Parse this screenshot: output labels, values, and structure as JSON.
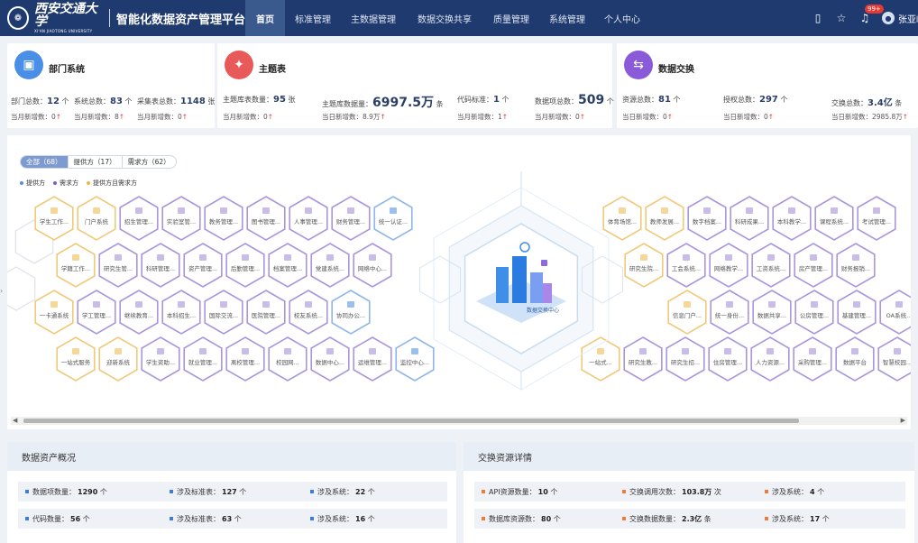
{
  "header": {
    "school_cn": "西安交通大学",
    "school_en": "XI'AN JIAOTONG UNIVERSITY",
    "platform_title": "智能化数据资产管理平台",
    "nav": [
      "首页",
      "标准管理",
      "主数据管理",
      "数据交换共享",
      "质量管理",
      "系统管理",
      "个人中心"
    ],
    "active_nav": "首页",
    "notification_badge": "99+",
    "user_name": "张亚峰"
  },
  "cards": {
    "dept": {
      "title": "部门系统",
      "icon_color": "#4a8fe7",
      "row1": [
        {
          "label": "部门总数：",
          "value": "12",
          "unit": "个"
        },
        {
          "label": "系统总数：",
          "value": "83",
          "unit": "个"
        },
        {
          "label": "采集表总数：",
          "value": "1148",
          "unit": "张"
        }
      ],
      "row2": [
        {
          "label": "当月新增数：",
          "value": "0"
        },
        {
          "label": "当月新增数：",
          "value": "8"
        },
        {
          "label": "当月新增数：",
          "value": "0"
        }
      ]
    },
    "theme": {
      "title": "主题表",
      "icon_color": "#e85a5a",
      "row1": [
        {
          "label": "主题库表数量：",
          "value": "95",
          "unit": "张"
        },
        {
          "label": "主题库数据量：",
          "value": "6997.5万",
          "unit": "条"
        },
        {
          "label": "代码标准：",
          "value": "1",
          "unit": "个"
        },
        {
          "label": "数据项总数：",
          "value": "509",
          "unit": "个"
        }
      ],
      "row2": [
        {
          "label": "当月新增数：",
          "value": "0"
        },
        {
          "label": "当日新增数：",
          "value": "8.9万"
        },
        {
          "label": "当月新增数：",
          "value": "1"
        },
        {
          "label": "当月新增数：",
          "value": "0"
        }
      ]
    },
    "exchange": {
      "title": "数据交换",
      "icon_color": "#8a5ad8",
      "row1": [
        {
          "label": "资源总数：",
          "value": "81",
          "unit": "个"
        },
        {
          "label": "授权总数：",
          "value": "297",
          "unit": "个"
        },
        {
          "label": "交换总数：",
          "value": "3.4亿",
          "unit": "条"
        }
      ],
      "row2": [
        {
          "label": "当日新增数：",
          "value": "0"
        },
        {
          "label": "当日新增数：",
          "value": "0"
        },
        {
          "label": "当日新增数：",
          "value": "2985.8万"
        }
      ]
    }
  },
  "hexmap": {
    "filters": [
      "全部（68）",
      "提供方（17）",
      "需求方（62）"
    ],
    "active_filter": "全部（68）",
    "legend": [
      {
        "label": "提供方",
        "color": "#5b8fd6"
      },
      {
        "label": "需求方",
        "color": "#7b5bd6"
      },
      {
        "label": "提供方且需求方",
        "color": "#f0b54a"
      }
    ],
    "left_labels": [
      [
        "学生工作...",
        "门户系统",
        "招生管理...",
        "实验室管...",
        "教务管理...",
        "图书管理...",
        "人事管理...",
        "财务管理...",
        "统一认证..."
      ],
      [
        "学籍工作...",
        "研究生管...",
        "科研管理...",
        "资产管理...",
        "后勤管理...",
        "档案管理...",
        "党建系统...",
        "网络中心..."
      ],
      [
        "一卡通系统",
        "学工管理...",
        "继续教育...",
        "本科招生...",
        "国际交流...",
        "医院管理...",
        "校友系统...",
        "协同办公..."
      ],
      [
        "一站式服务",
        "迎新系统",
        "学生资助...",
        "就业管理...",
        "离校管理...",
        "校园网...",
        "数据中心...",
        "运维管理...",
        "监控中心..."
      ]
    ],
    "right_labels": [
      [
        "体育场馆...",
        "教师发展...",
        "数字档案...",
        "科研成果...",
        "本科教学...",
        "课程系统...",
        "考试管理..."
      ],
      [
        "研究生院...",
        "工会系统...",
        "网络教学...",
        "工资系统...",
        "房产管理...",
        "财务报销..."
      ],
      [
        "信息门户...",
        "统一身份...",
        "数据共享...",
        "公房管理...",
        "基建管理...",
        "OA系统..."
      ],
      [
        "一站式...",
        "研究生教...",
        "研究生招...",
        "住房管理...",
        "人力资源...",
        "采购管理...",
        "数据平台",
        "智慧校园..."
      ]
    ],
    "center_label": "数据交换中心"
  },
  "overview": {
    "title": "数据资产概况",
    "rows": [
      [
        {
          "label": "数据项数量：",
          "value": "1290",
          "unit": "个"
        },
        {
          "label": "涉及标准表：",
          "value": "127",
          "unit": "个"
        },
        {
          "label": "涉及系统：",
          "value": "22",
          "unit": "个"
        }
      ],
      [
        {
          "label": "代码数量：",
          "value": "56",
          "unit": "个"
        },
        {
          "label": "涉及标准表：",
          "value": "63",
          "unit": "个"
        },
        {
          "label": "涉及系统：",
          "value": "16",
          "unit": "个"
        }
      ]
    ],
    "accent": "#3b7ddd"
  },
  "exchange_detail": {
    "title": "交换资源详情",
    "rows": [
      [
        {
          "label": "API资源数量：",
          "value": "10",
          "unit": "个"
        },
        {
          "label": "交换调用次数：",
          "value": "103.8万",
          "unit": "次"
        },
        {
          "label": "涉及系统：",
          "value": "4",
          "unit": "个"
        }
      ],
      [
        {
          "label": "数据库资源数：",
          "value": "80",
          "unit": "个"
        },
        {
          "label": "交换数据数量：",
          "value": "2.3亿",
          "unit": "条"
        },
        {
          "label": "涉及系统：",
          "value": "17",
          "unit": "个"
        }
      ]
    ],
    "accent": "#f07a3a"
  }
}
